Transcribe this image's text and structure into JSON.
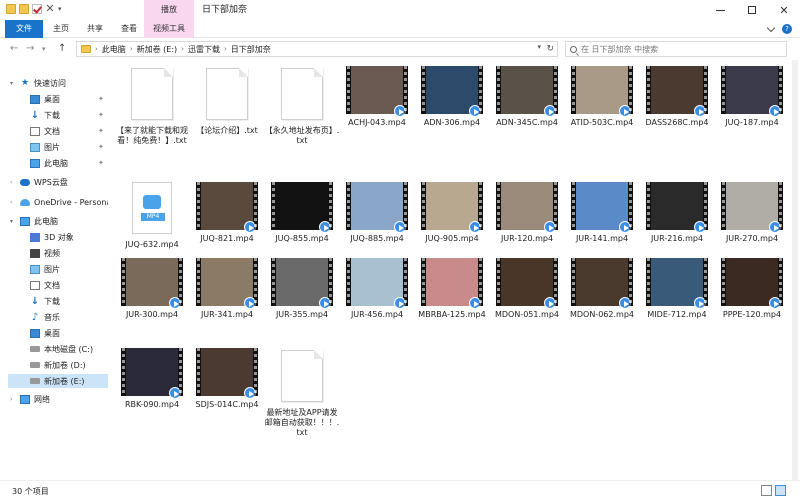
{
  "title_bar": {
    "context_tab": "播放",
    "window_title": "日下部加奈",
    "minimize": "—",
    "maximize": "□",
    "close": "✕"
  },
  "ribbon": {
    "tabs": [
      "文件",
      "主页",
      "共享",
      "查看",
      "视频工具"
    ]
  },
  "address": {
    "crumbs": [
      "此电脑",
      "新加卷 (E:)",
      "迅雷下载",
      "日下部加奈"
    ],
    "search_placeholder": "在 日下部加奈 中搜索"
  },
  "nav": {
    "items": [
      {
        "label": "快速访问",
        "icon": "star-icon",
        "pinned": false
      },
      {
        "label": "桌面",
        "icon": "desktop-icon",
        "pinned": true
      },
      {
        "label": "下载",
        "icon": "download-icon",
        "pinned": true
      },
      {
        "label": "文档",
        "icon": "document-icon",
        "pinned": true
      },
      {
        "label": "图片",
        "icon": "picture-icon",
        "pinned": true
      },
      {
        "label": "此电脑",
        "icon": "computer-icon",
        "pinned": true
      },
      {
        "label": "WPS云盘",
        "icon": "wps-cloud-icon",
        "pinned": false
      },
      {
        "label": "OneDrive - Persona",
        "icon": "onedrive-icon",
        "pinned": false
      },
      {
        "label": "此电脑",
        "icon": "computer-icon",
        "pinned": false
      },
      {
        "label": "3D 对象",
        "icon": "3d-objects-icon",
        "pinned": false
      },
      {
        "label": "视频",
        "icon": "video-icon",
        "pinned": false
      },
      {
        "label": "图片",
        "icon": "picture-icon",
        "pinned": false
      },
      {
        "label": "文档",
        "icon": "document-icon",
        "pinned": false
      },
      {
        "label": "下载",
        "icon": "download-icon",
        "pinned": false
      },
      {
        "label": "音乐",
        "icon": "music-icon",
        "pinned": false
      },
      {
        "label": "桌面",
        "icon": "desktop-icon",
        "pinned": false
      },
      {
        "label": "本地磁盘 (C:)",
        "icon": "drive-icon",
        "pinned": false
      },
      {
        "label": "新加卷 (D:)",
        "icon": "drive-icon",
        "pinned": false
      },
      {
        "label": "新加卷 (E:)",
        "icon": "drive-icon",
        "pinned": false,
        "selected": true
      },
      {
        "label": "网络",
        "icon": "network-icon",
        "pinned": false
      }
    ]
  },
  "files": [
    {
      "name": "【来了就能下载和观看！纯免费！】.txt",
      "kind": "txt"
    },
    {
      "name": "【论坛介绍】.txt",
      "kind": "txt"
    },
    {
      "name": "【永久地址发布页】.txt",
      "kind": "txt"
    },
    {
      "name": "ACHJ-043.mp4",
      "kind": "video",
      "color": "#6b5a52"
    },
    {
      "name": "ADN-306.mp4",
      "kind": "video",
      "color": "#2d4a6a"
    },
    {
      "name": "ADN-345C.mp4",
      "kind": "video",
      "color": "#5a5248"
    },
    {
      "name": "ATID-503C.mp4",
      "kind": "video",
      "color": "#a89a86"
    },
    {
      "name": "DASS268C.mp4",
      "kind": "video",
      "color": "#4a3a30"
    },
    {
      "name": "JUQ-187.mp4",
      "kind": "video",
      "color": "#3a3a4a"
    },
    {
      "name": "JUQ-632.mp4",
      "kind": "mp4plain"
    },
    {
      "name": "JUQ-821.mp4",
      "kind": "video",
      "color": "#5a4a3e"
    },
    {
      "name": "JUQ-855.mp4",
      "kind": "video",
      "color": "#121212"
    },
    {
      "name": "JUQ-885.mp4",
      "kind": "video",
      "color": "#8aa6c8"
    },
    {
      "name": "JUQ-905.mp4",
      "kind": "video",
      "color": "#b8a890"
    },
    {
      "name": "JUR-120.mp4",
      "kind": "video",
      "color": "#9a8a7a"
    },
    {
      "name": "JUR-141.mp4",
      "kind": "video",
      "color": "#5a8ac8"
    },
    {
      "name": "JUR-216.mp4",
      "kind": "video",
      "color": "#2a2a2a"
    },
    {
      "name": "JUR-270.mp4",
      "kind": "video",
      "color": "#b0aca6"
    },
    {
      "name": "JUR-300.mp4",
      "kind": "video",
      "color": "#7a6a5a"
    },
    {
      "name": "JUR-341.mp4",
      "kind": "video",
      "color": "#8a7a66"
    },
    {
      "name": "JUR-355.mp4",
      "kind": "video",
      "color": "#6a6a6a"
    },
    {
      "name": "JUR-456.mp4",
      "kind": "video",
      "color": "#a8c0d0"
    },
    {
      "name": "MBRBA-125.mp4",
      "kind": "video",
      "color": "#c88a8a"
    },
    {
      "name": "MDON-051.mp4",
      "kind": "video",
      "color": "#4a3628"
    },
    {
      "name": "MDON-062.mp4",
      "kind": "video",
      "color": "#4a3a2e"
    },
    {
      "name": "MIDE-712.mp4",
      "kind": "video",
      "color": "#3a5a7a"
    },
    {
      "name": "PPPE-120.mp4",
      "kind": "video",
      "color": "#3a2a22"
    },
    {
      "name": "RBK-090.mp4",
      "kind": "video",
      "color": "#2a2a3a"
    },
    {
      "name": "SDJS-014C.mp4",
      "kind": "video",
      "color": "#4a3a32"
    },
    {
      "name": "最新地址及APP请发邮箱自动获取！！！.txt",
      "kind": "txt"
    }
  ],
  "status": {
    "count": "30 个项目"
  }
}
